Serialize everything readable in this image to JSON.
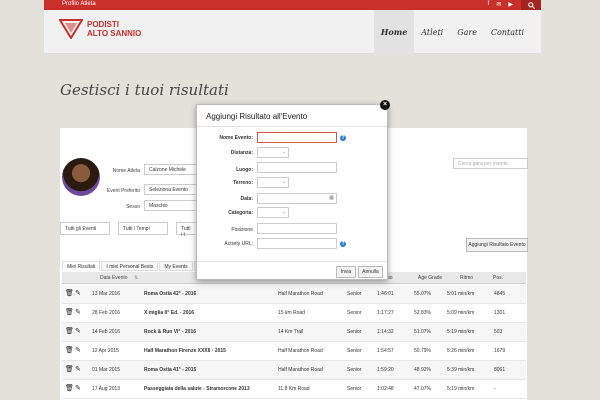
{
  "topbar": {
    "profile_link": "Profilo Atleta",
    "social_icons": [
      "facebook-icon",
      "mail-icon",
      "youtube-icon"
    ]
  },
  "logo": {
    "line1": "PODISTI",
    "line2": "ALTO SANNIO"
  },
  "nav": [
    {
      "label": "Home",
      "active": true
    },
    {
      "label": "Atleti",
      "active": false
    },
    {
      "label": "Gare",
      "active": false
    },
    {
      "label": "Contatti",
      "active": false
    }
  ],
  "page_title": "Gestisci i tuoi risultati",
  "athlete": {
    "name_label": "Nome Atleta",
    "name_value": "Calzone Michele",
    "event_label": "Event Preferito",
    "event_value": "Seleziona Evento",
    "sex_label": "Sesso",
    "sex_value": "Maschio"
  },
  "search": {
    "placeholder": "Cerca gara per evento"
  },
  "filters": {
    "events": "Tutti gli Eventi",
    "times": "Tutti i Tempi",
    "third": "Tutti i t"
  },
  "add_result_button": "Aggiungi Risultato Evento",
  "tabs": [
    {
      "label": "Miei Risultati",
      "active": true
    },
    {
      "label": "I miei Personal Bests",
      "active": false
    },
    {
      "label": "My Events",
      "active": false
    },
    {
      "label": "S",
      "active": false
    }
  ],
  "table": {
    "headers": [
      "Data Evento",
      "po",
      "Age Grade",
      "Ritmo",
      "Pos."
    ],
    "rows": [
      {
        "date": "13 Mar 2016",
        "event": "Roma Ostia 42° - 2016",
        "distance": "Half Marathon Road",
        "category": "Senior",
        "time": "1:46:01",
        "age_grade": "55.07%",
        "pace": "5:01 min/km",
        "pos": "4845"
      },
      {
        "date": "28 Feb 2016",
        "event": "X miglia II° Ed. - 2016",
        "distance": "15 km Road",
        "category": "Senior",
        "time": "1:17:27",
        "age_grade": "52.83%",
        "pace": "5:09 min/km",
        "pos": "1301"
      },
      {
        "date": "14 Feb 2016",
        "event": "Rock & Run VI° - 2016",
        "distance": "14 Km Trail",
        "category": "Senior",
        "time": "1:14:32",
        "age_grade": "51.07%",
        "pace": "5:19 min/km",
        "pos": "503"
      },
      {
        "date": "12 Apr 2015",
        "event": "Half Marathon Firenze XXXII - 2015",
        "distance": "Half Marathon Road",
        "category": "Senior",
        "time": "1:54:57",
        "age_grade": "50.79%",
        "pace": "5:26 min/km",
        "pos": "1679"
      },
      {
        "date": "01 Mar 2015",
        "event": "Roma Ostia 41° - 2015",
        "distance": "Half Marathon Road",
        "category": "Senior",
        "time": "1:59:20",
        "age_grade": "48.92%",
        "pace": "5:39 min/km",
        "pos": "8061"
      },
      {
        "date": "17 Aug 2013",
        "event": "Passeggiata della salute - Stramorcone 2013",
        "distance": "11.8 Km Road",
        "category": "Senior",
        "time": "1:02:48",
        "age_grade": "47.07%",
        "pace": "5:19 min/km",
        "pos": "-"
      }
    ]
  },
  "modal": {
    "title": "Aggiungi Risultato all'Evento",
    "fields": {
      "event_name": "Nome Evento:",
      "distance": "Distanza:",
      "place": "Luogo:",
      "terrain": "Terreno:",
      "date": "Data:",
      "category": "Categoria:",
      "position": "Posizione",
      "activity_url": "Activity URL:"
    },
    "submit": "Invia",
    "cancel": "Annulla"
  }
}
